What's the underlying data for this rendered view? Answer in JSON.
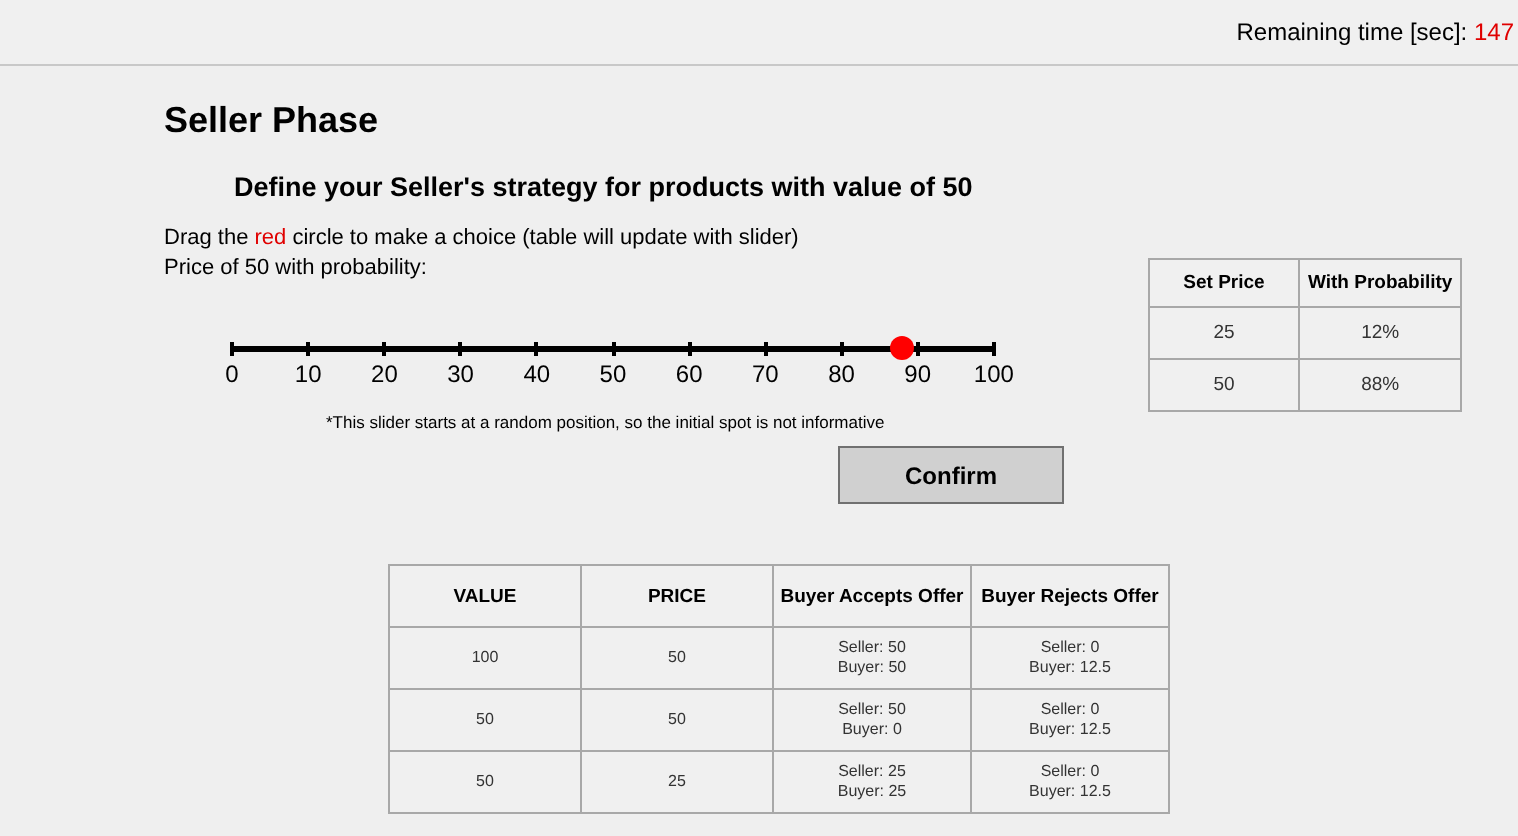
{
  "timer": {
    "label": "Remaining time [sec]:",
    "value": "147"
  },
  "title": "Seller Phase",
  "subtitle": "Define your Seller's strategy for products with value of 50",
  "instruction": {
    "before": "Drag the ",
    "highlight": "red",
    "after": " circle to make a choice (table will update with slider)"
  },
  "prompt": "Price of 50 with probability:",
  "slider": {
    "level": 0.88,
    "ticks": [
      "0",
      "10",
      "20",
      "30",
      "40",
      "50",
      "60",
      "70",
      "80",
      "90",
      "100"
    ]
  },
  "note": "*This slider starts at a random position, so the initial spot is not informative",
  "confirm_button": "Confirm",
  "strategy_table": {
    "columns": [
      "Set Price",
      "With Probability"
    ],
    "rows": [
      [
        "25",
        "12%"
      ],
      [
        "50",
        "88%"
      ]
    ]
  },
  "payoff_table": {
    "columns": [
      "VALUE",
      "PRICE",
      "Buyer Accepts Offer",
      "Buyer Rejects Offer"
    ],
    "rows": [
      {
        "value": "100",
        "price": "50",
        "accepts": [
          "Seller: 50",
          "Buyer: 50"
        ],
        "rejects": [
          "Seller: 0",
          "Buyer: 12.5"
        ]
      },
      {
        "value": "50",
        "price": "50",
        "accepts": [
          "Seller: 50",
          "Buyer: 0"
        ],
        "rejects": [
          "Seller: 0",
          "Buyer: 12.5"
        ]
      },
      {
        "value": "50",
        "price": "25",
        "accepts": [
          "Seller: 25",
          "Buyer: 25"
        ],
        "rejects": [
          "Seller: 0",
          "Buyer: 12.5"
        ]
      }
    ]
  }
}
